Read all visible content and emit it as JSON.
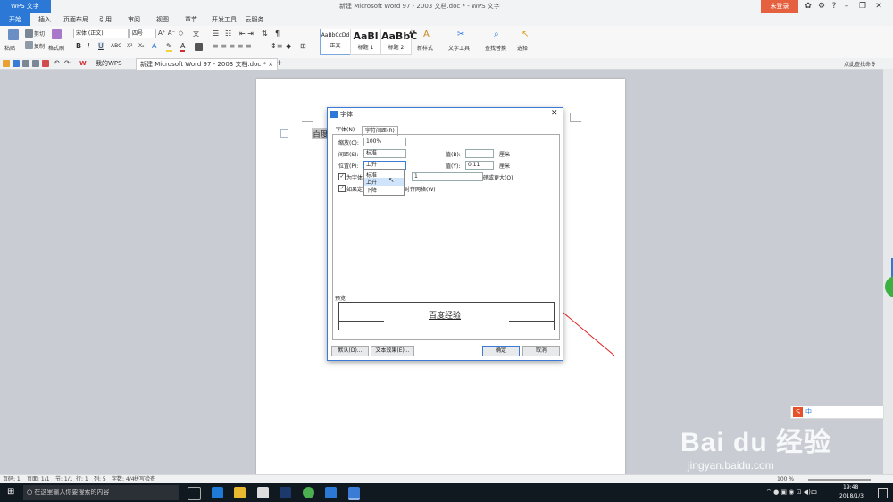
{
  "titlebar": {
    "app_label": "WPS 文字",
    "doc_title": "新建 Microsoft Word 97 - 2003 文档.doc * - WPS 文字",
    "login_label": "未登录"
  },
  "menu": {
    "tabs": [
      "开始",
      "插入",
      "页面布局",
      "引用",
      "审阅",
      "视图",
      "章节",
      "开发工具",
      "云服务"
    ]
  },
  "ribbon": {
    "paste": "粘贴",
    "cut": "剪切",
    "copy": "复制",
    "format_painter": "格式刷",
    "font_name": "宋体 (正文)",
    "font_size": "四号",
    "styles": [
      {
        "preview": "AaBbCcDd",
        "name": "正文"
      },
      {
        "preview": "AaBl",
        "name": "标题 1"
      },
      {
        "preview": "AaBbC",
        "name": "标题 2"
      }
    ],
    "new_style": "新样式",
    "text_tools": "文字工具",
    "find_replace": "查找替换",
    "select": "选择"
  },
  "quickbar": {
    "tab_mywps": "我的WPS",
    "tab_doc": "新建 Microsoft Word 97 - 2003 文档.doc *",
    "find_command": "点此查找命令"
  },
  "document": {
    "text": "百度"
  },
  "dialog": {
    "title": "字体",
    "tab_font": "字体(N)",
    "tab_spacing": "字符间距(R)",
    "scale_label": "缩放(C):",
    "scale_value": "100%",
    "spacing_label": "间距(S):",
    "spacing_value": "标准",
    "position_label": "位置(P):",
    "position_value": "上升",
    "value_b_label": "值(B):",
    "value_b": "",
    "unit_b": "厘米",
    "value_y_label": "值(Y):",
    "value_y": "0.11",
    "unit_y": "厘米",
    "kerning_label": "为字体",
    "kerning_value": "1",
    "kerning_suffix": "磅或更大(O)",
    "grid_label": "如果定",
    "grid_suffix": "对齐网格(W)",
    "dropdown_options": [
      "标准",
      "上升",
      "下降"
    ],
    "preview_label": "预览",
    "preview_text": "百度经验",
    "default_button": "默认(D)...",
    "text_effect_button": "文本效果(E)...",
    "ok_button": "确定",
    "cancel_button": "取消"
  },
  "status": {
    "items": [
      "页码: 1",
      "页面: 1/1",
      "节: 1/1",
      "行: 1",
      "列: 5",
      "字数: 4/4",
      "拼写检查"
    ],
    "zoom": "100 %"
  },
  "taskbar": {
    "search_placeholder": "在这里输入你要搜索的内容",
    "time": "19:48",
    "date": "2018/1/3",
    "ime": "中"
  },
  "watermark": {
    "brand": "Bai du 经验",
    "url": "jingyan.baidu.com"
  },
  "colors": {
    "accent": "#2b78d6",
    "login": "#e5603e",
    "annotation_line": "#e02020"
  }
}
